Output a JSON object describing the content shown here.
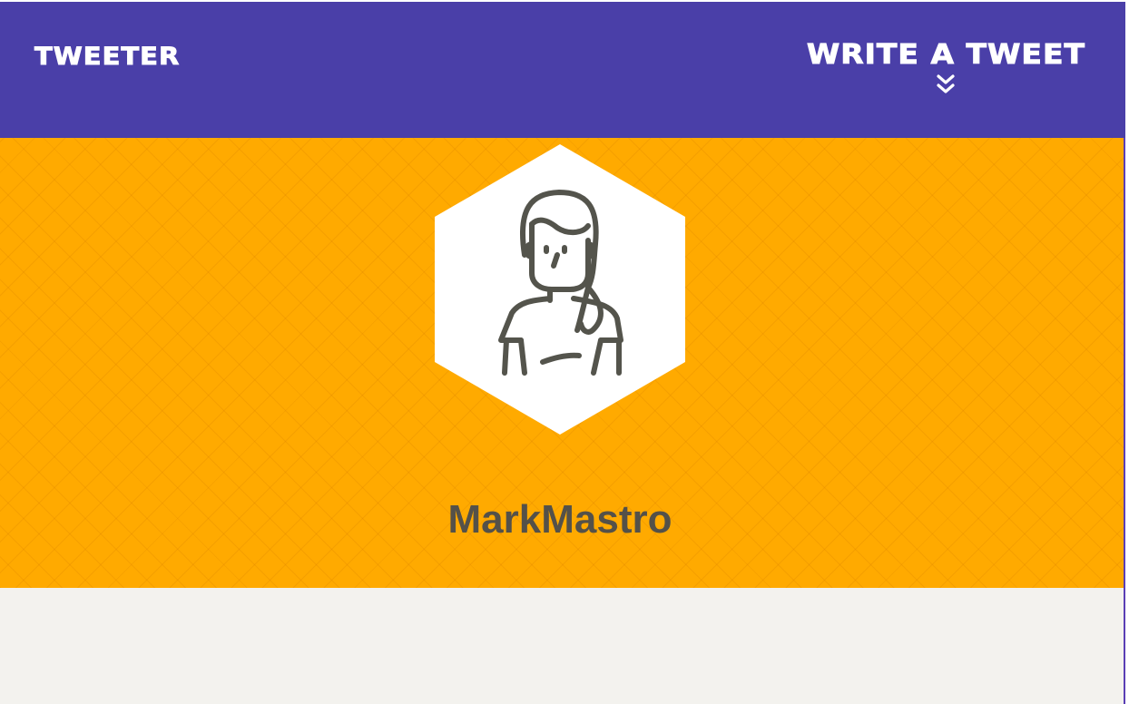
{
  "navbar": {
    "brand": "Tweeter",
    "compose_label": "Write a tweet",
    "compose_icon": "double-chevron-down-icon"
  },
  "profile": {
    "avatar_icon": "woman-avatar-icon",
    "handle": "MarkMastro"
  },
  "colors": {
    "navbar": "#4a3fa8",
    "hero": "#ffaa00",
    "handle_text": "#545149",
    "content_bg": "#f3f2ee"
  }
}
